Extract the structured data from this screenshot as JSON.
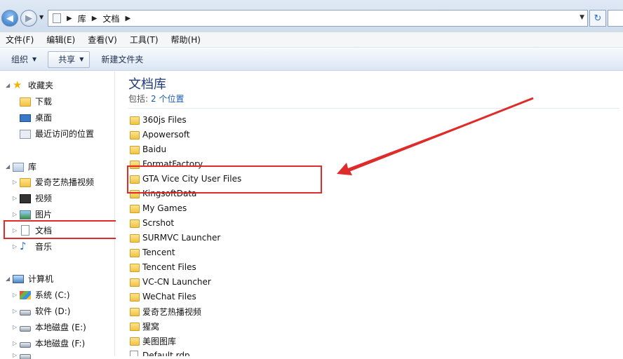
{
  "address": {
    "crumbs": [
      "库",
      "文档"
    ],
    "separator": "▶"
  },
  "menubar": [
    "文件(F)",
    "编辑(E)",
    "查看(V)",
    "工具(T)",
    "帮助(H)"
  ],
  "toolbar": {
    "organize": "组织",
    "share": "共享",
    "new_folder": "新建文件夹"
  },
  "nav": {
    "favorites": {
      "label": "收藏夹",
      "items": [
        "下载",
        "桌面",
        "最近访问的位置"
      ]
    },
    "libraries": {
      "label": "库",
      "items": [
        "爱奇艺热播视频",
        "视频",
        "图片",
        "文档",
        "音乐"
      ]
    },
    "computer": {
      "label": "计算机",
      "items": [
        "系统 (C:)",
        "软件 (D:)",
        "本地磁盘 (E:)",
        "本地磁盘 (F:)"
      ]
    }
  },
  "library": {
    "title": "文档库",
    "includes_label": "包括:",
    "locations_link": "2 个位置"
  },
  "files": [
    "360js Files",
    "Apowersoft",
    "Baidu",
    "FormatFactory",
    "GTA Vice City User Files",
    "KingsoftData",
    "My Games",
    "Scrshot",
    "SURMVC Launcher",
    "Tencent",
    "Tencent Files",
    "VC-CN Launcher",
    "WeChat Files",
    "爱奇艺热播视频",
    "猩窝",
    "美图图库",
    "Default.rdp"
  ],
  "colors": {
    "annotation_red": "#e02b2b",
    "title_blue": "#1e3a78",
    "link_blue": "#1a5bb5"
  }
}
